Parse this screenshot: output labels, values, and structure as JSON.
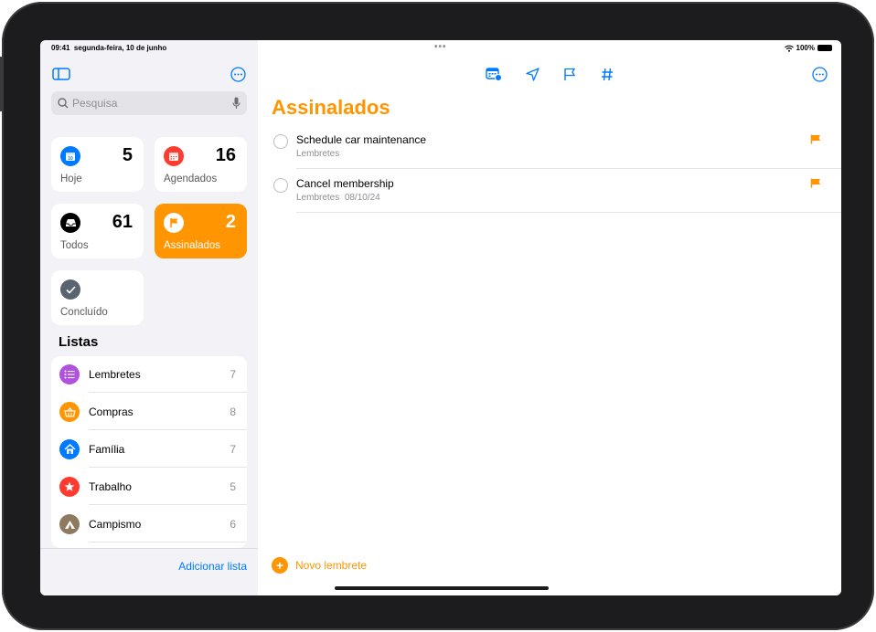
{
  "status": {
    "time": "09:41",
    "date": "segunda-feira, 10 de junho",
    "battery": "100%"
  },
  "sidebar": {
    "search_placeholder": "Pesquisa",
    "tiles": [
      {
        "label": "Hoje",
        "count": "5",
        "color": "#007aff",
        "icon": "calendar-today-icon"
      },
      {
        "label": "Agendados",
        "count": "16",
        "color": "#ff3b30",
        "icon": "calendar-icon"
      },
      {
        "label": "Todos",
        "count": "61",
        "color": "#000000",
        "icon": "tray-icon"
      },
      {
        "label": "Assinalados",
        "count": "2",
        "color": "#ff9500",
        "icon": "flag-icon"
      },
      {
        "label": "Concluído",
        "count": "",
        "color": "#5a6470",
        "icon": "checkmark-icon"
      }
    ],
    "lists_title": "Listas",
    "lists": [
      {
        "name": "Lembretes",
        "count": "7",
        "color": "#af52de",
        "icon": "list-bullet-icon"
      },
      {
        "name": "Compras",
        "count": "8",
        "color": "#ff9500",
        "icon": "basket-icon"
      },
      {
        "name": "Família",
        "count": "7",
        "color": "#007aff",
        "icon": "house-icon"
      },
      {
        "name": "Trabalho",
        "count": "5",
        "color": "#ff3b30",
        "icon": "star-icon"
      },
      {
        "name": "Campismo",
        "count": "6",
        "color": "#8e7a5e",
        "icon": "tent-icon"
      }
    ],
    "add_list": "Adicionar lista"
  },
  "main": {
    "title": "Assinalados",
    "items": [
      {
        "title": "Schedule car maintenance",
        "list": "Lembretes",
        "date": ""
      },
      {
        "title": "Cancel membership",
        "list": "Lembretes",
        "date": "08/10/24"
      }
    ],
    "new_reminder": "Novo lembrete"
  },
  "colors": {
    "accent": "#ff9500",
    "link": "#007aff"
  }
}
